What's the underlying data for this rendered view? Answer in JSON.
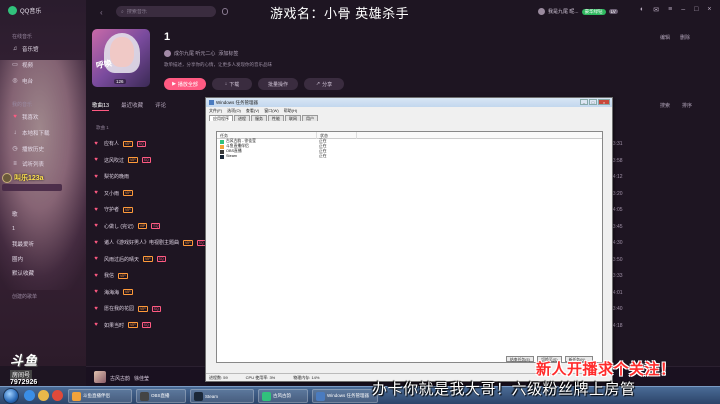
{
  "app": {
    "name": "QQ音乐"
  },
  "stream": {
    "game_title": "游戏名：小骨 英雄杀手",
    "gift_user": "叫乐123a",
    "douyu_logo": "斗鱼",
    "douyu_tag": "房间号",
    "douyu_room": "7972926",
    "banner_red": "新人开播求个关注！",
    "banner_white": "办卡你就是我大哥！六级粉丝牌上房管"
  },
  "sidebar": {
    "section_online": "在线音乐",
    "online_items": [
      {
        "label": "音乐馆",
        "icon": "music-note-icon"
      },
      {
        "label": "视频",
        "icon": "video-icon"
      },
      {
        "label": "电台",
        "icon": "radio-icon"
      }
    ],
    "section_mine": "我的音乐",
    "mine_items": [
      {
        "label": "我喜欢",
        "icon": "heart-icon"
      },
      {
        "label": "本地和下载",
        "icon": "download-icon"
      },
      {
        "label": "播放历史",
        "icon": "history-icon"
      },
      {
        "label": "试听列表",
        "icon": "list-icon"
      }
    ],
    "playlist_items": [
      "歌",
      "1",
      "我最爱听",
      "圈内",
      "默认收藏"
    ],
    "section_created": "创建的歌单"
  },
  "topbar": {
    "search_placeholder": "搜索音乐",
    "username": "我是九尾 昵...",
    "badge_green": "豪华绿钻",
    "badge_small": "LV",
    "window_controls": [
      "skin-icon",
      "mail-icon",
      "settings-icon",
      "minimize-icon",
      "maximize-icon",
      "close-icon"
    ]
  },
  "album": {
    "title": "1",
    "creator": "成尔九尾 听元二心",
    "creator_suffix": "添加标签",
    "description": "歌单描述，分享你的心情，让更多人发现你的音乐品味",
    "cover_text": "呼唤",
    "cover_count": "126",
    "buttons": {
      "play": "播放全部",
      "download": "下载",
      "batch": "批量操作",
      "share": "分享"
    },
    "right_ops": [
      "编辑",
      "删除"
    ]
  },
  "tabs": {
    "items": [
      "歌曲13",
      "最近收藏",
      "评论"
    ],
    "tools": [
      "搜索",
      "排序"
    ],
    "column_header": "歌曲 1"
  },
  "songs": [
    {
      "title": "应有人",
      "vip": "VIP",
      "sq": "SQ",
      "duration": "03:31"
    },
    {
      "title": "这风吹过",
      "vip": "VIP",
      "sq": "SQ",
      "duration": "03:58"
    },
    {
      "title": "梨花的晚雨",
      "vip": "",
      "sq": "",
      "duration": "04:12"
    },
    {
      "title": "又小雨",
      "vip": "VIP",
      "sq": "",
      "duration": "03:20"
    },
    {
      "title": "守护者",
      "vip": "VIP",
      "sq": "",
      "duration": "04:05"
    },
    {
      "title": "心做し (完记)",
      "vip": "VIP",
      "sq": "SQ",
      "duration": "03:45"
    },
    {
      "title": "诸人《游戏好男人》电视剧主题曲",
      "vip": "VIP",
      "sq": "SQ",
      "duration": "04:30"
    },
    {
      "title": "风雨过后的晴天",
      "vip": "VIP",
      "sq": "SQ",
      "duration": "03:50"
    },
    {
      "title": "我信",
      "vip": "VIP",
      "sq": "",
      "duration": "03:33"
    },
    {
      "title": "海海海",
      "vip": "VIP",
      "sq": "",
      "duration": "04:01"
    },
    {
      "title": "愿在我的花园",
      "vip": "VIP",
      "sq": "SQ",
      "duration": "03:40"
    },
    {
      "title": "如果当时",
      "vip": "VIP",
      "sq": "SQ",
      "duration": "04:18"
    }
  ],
  "player": {
    "song": "古风古韵",
    "artist": "徐佳莹"
  },
  "task_manager": {
    "title": "Windows 任务管理器",
    "menu": [
      "文件(F)",
      "选项(O)",
      "查看(V)",
      "窗口(W)",
      "帮助(H)"
    ],
    "tabs": [
      "应用程序",
      "进程",
      "服务",
      "性能",
      "联网",
      "用户"
    ],
    "columns": [
      "任务",
      "状态"
    ],
    "rows": [
      {
        "task": "古风古韵 - 徐佳莹",
        "status": "正在",
        "color": "#31c27c"
      },
      {
        "task": "斗鱼直播伴侣",
        "status": "正在",
        "color": "#f2a33a"
      },
      {
        "task": "OBS直播",
        "status": "正在",
        "color": "#3a3a3a"
      },
      {
        "task": "Steam",
        "status": "正在",
        "color": "#1b2838"
      }
    ],
    "buttons": [
      "结束任务(E)",
      "切换至(S)",
      "新任务(N)..."
    ],
    "status_bar": [
      "进程数: 59",
      "CPU 使用率: 3%",
      "物理内存: 14%"
    ]
  },
  "taskbar": {
    "apps": [
      {
        "label": "斗鱼直播伴侣",
        "color": "#f2a33a"
      },
      {
        "label": "OBS直播",
        "color": "#444444"
      },
      {
        "label": "Steam",
        "color": "#1b2838"
      },
      {
        "label": "古风古韵",
        "color": "#31c27c"
      },
      {
        "label": "Windows 任务管理器",
        "color": "#4a7bbf"
      }
    ]
  }
}
